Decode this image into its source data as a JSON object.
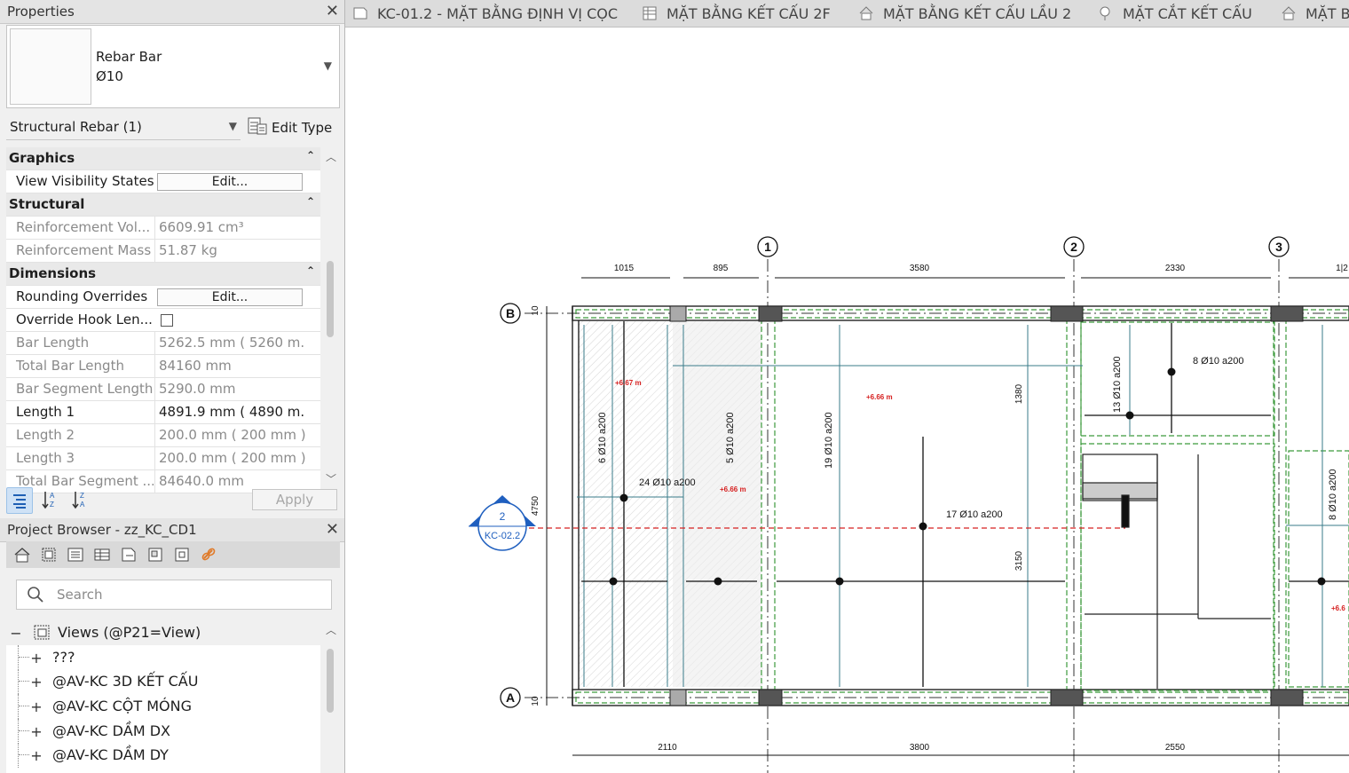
{
  "properties": {
    "title": "Properties",
    "type_name_line1": "Rebar Bar",
    "type_name_line2": "Ø10",
    "filter": "Structural Rebar (1)",
    "edit_type": "Edit Type",
    "apply": "Apply",
    "rows": [
      {
        "kind": "group",
        "label": "Graphics"
      },
      {
        "kind": "button",
        "label": "View Visibility States",
        "value": "Edit..."
      },
      {
        "kind": "group",
        "label": "Structural"
      },
      {
        "kind": "ro",
        "label": "Reinforcement Vol...",
        "value": "6609.91 cm³"
      },
      {
        "kind": "ro",
        "label": "Reinforcement Mass",
        "value": "51.87 kg"
      },
      {
        "kind": "group",
        "label": "Dimensions"
      },
      {
        "kind": "button",
        "label": "Rounding Overrides",
        "value": "Edit..."
      },
      {
        "kind": "check",
        "label": "Override Hook Len..."
      },
      {
        "kind": "ro",
        "label": "Bar Length",
        "value": "5262.5 mm ( 5260 m..."
      },
      {
        "kind": "ro",
        "label": "Total Bar Length",
        "value": "84160 mm"
      },
      {
        "kind": "ro",
        "label": "Bar Segment Length",
        "value": "5290.0 mm"
      },
      {
        "kind": "edit",
        "label": "Length 1",
        "value": "4891.9 mm ( 4890 m..."
      },
      {
        "kind": "ro",
        "label": "Length 2",
        "value": "200.0 mm ( 200 mm )"
      },
      {
        "kind": "ro",
        "label": "Length 3",
        "value": "200.0 mm ( 200 mm )"
      },
      {
        "kind": "ro",
        "label": "Total Bar Segment ...",
        "value": "84640.0 mm"
      }
    ]
  },
  "project_browser": {
    "title": "Project Browser - zz_KC_CD1",
    "search_placeholder": "Search",
    "root": "Views (@P21=View)",
    "items": [
      "???",
      "@AV-KC 3D KẾT CẤU",
      "@AV-KC CỘT MÓNG",
      "@AV-KC DẦM DX",
      "@AV-KC DẦM DY"
    ]
  },
  "tabs": [
    {
      "label": "KC-01.2 - MẶT BẰNG ĐỊNH VỊ CỌC",
      "icon": "sheet-icon"
    },
    {
      "label": "MẶT BẰNG KẾT CẤU 2F",
      "icon": "schedule-icon"
    },
    {
      "label": "MẶT BẰNG KẾT CẤU LẦU 2",
      "icon": "floor-plan-icon"
    },
    {
      "label": "MẶT CẮT KẾT CẤU",
      "icon": "section-icon"
    },
    {
      "label": "MẶT B",
      "icon": "floor-plan-icon"
    }
  ],
  "drawing": {
    "grids": [
      "1",
      "2",
      "3"
    ],
    "rows": [
      "B",
      "A"
    ],
    "top_dims": [
      "1015",
      "895",
      "3580",
      "2330",
      "1|2"
    ],
    "bottom_dims": [
      "2110",
      "3800",
      "2550"
    ],
    "left_dims": [
      "10",
      "4750",
      "10"
    ],
    "section_tag": {
      "number": "2",
      "sheet": "KC-02.2"
    },
    "rebar_tags": [
      "6 Ø10 a200",
      "24 Ø10 a200",
      "5 Ø10 a200",
      "19 Ø10 a200",
      "17 Ø10 a200",
      "13 Ø10 a200",
      "8 Ø10 a200",
      "8 Ø10 a200"
    ],
    "level_tags": [
      "+6.67 m",
      "+6.66 m",
      "+6.66 m",
      "+6.6"
    ],
    "inner_dims": [
      "1380",
      "3150"
    ]
  }
}
